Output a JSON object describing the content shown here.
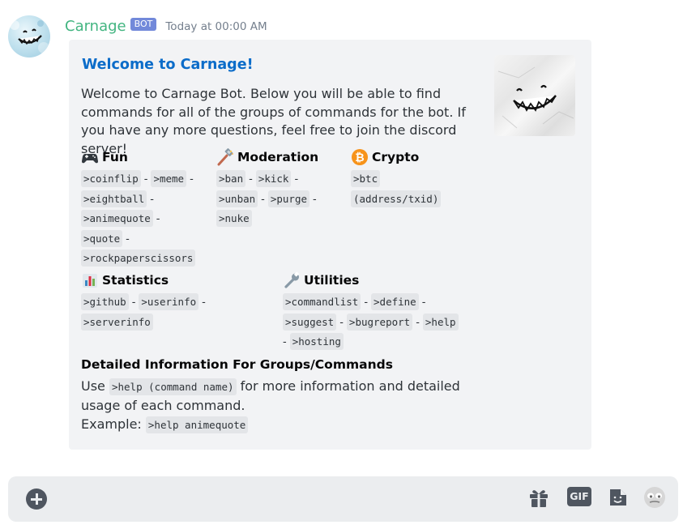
{
  "author": {
    "name": "Carnage",
    "tag": "BOT",
    "timestamp": "Today at 00:00 AM",
    "name_color": "#43b581"
  },
  "embed": {
    "title": "Welcome to Carnage!",
    "title_color": "#0b6cc9",
    "description": "Welcome to Carnage Bot. Below you will be able to find commands for all of the groups of commands for the bot. If you have any more questions, feel free to join the discord server!",
    "fields": {
      "fun": {
        "icon": "game-controller-icon",
        "name": "Fun",
        "commands": [
          ">coinflip",
          ">meme",
          ">eightball",
          ">animequote",
          ">quote",
          ">rockpaperscissors"
        ]
      },
      "moderation": {
        "icon": "hammer-icon",
        "name": "Moderation",
        "commands": [
          ">ban",
          ">kick",
          ">unban",
          ">purge",
          ">nuke"
        ]
      },
      "crypto": {
        "icon": "bitcoin-icon",
        "name": "Crypto",
        "commands": [
          ">btc",
          "(address/txid)"
        ]
      },
      "statistics": {
        "icon": "bar-chart-icon",
        "name": "Statistics",
        "commands": [
          ">github",
          ">userinfo",
          ">serverinfo"
        ]
      },
      "utilities": {
        "icon": "wrench-icon",
        "name": "Utilities",
        "commands": [
          ">commandlist",
          ">define",
          ">suggest",
          ">bugreport",
          ">help",
          ">hosting"
        ]
      }
    },
    "separator": "-",
    "detail": {
      "title": "Detailed Information For Groups/Commands",
      "use_prefix": "Use",
      "use_code": ">help (command name)",
      "use_suffix": "for more information and detailed usage of each command.",
      "example_label": "Example:",
      "example_code": ">help animequote"
    }
  },
  "chat_bar": {
    "icons": [
      "plus-icon",
      "gift-icon",
      "gif-icon",
      "sticker-icon",
      "emoji-icon"
    ],
    "gif_label": "GIF"
  }
}
